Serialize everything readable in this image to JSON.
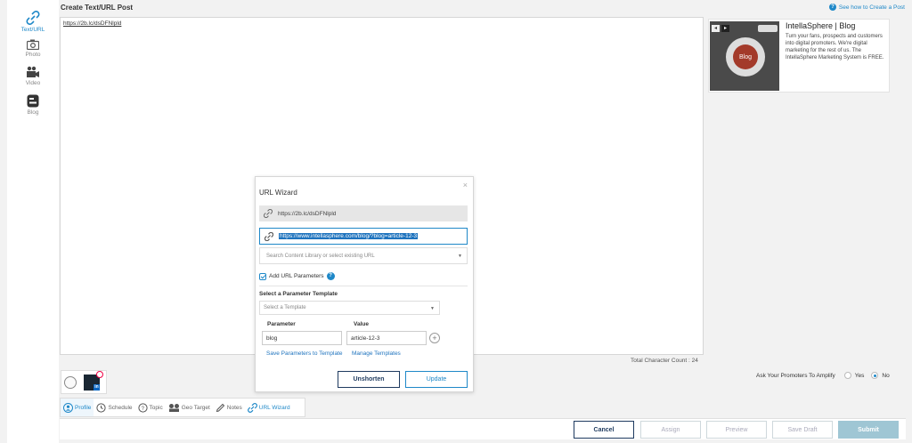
{
  "header": {
    "title": "Create Text/URL Post",
    "help_link": "See how to Create a Post"
  },
  "sidebar": {
    "items": [
      {
        "label": "Text/URL",
        "icon": "link-icon",
        "active": true
      },
      {
        "label": "Photo",
        "icon": "camera-icon"
      },
      {
        "label": "Video",
        "icon": "video-camera-icon"
      },
      {
        "label": "Blog",
        "icon": "blog-icon"
      }
    ]
  },
  "editor": {
    "text": "https://2b.lc/dsDFNlpld"
  },
  "preview": {
    "title": "IntellaSphere | Blog",
    "description": "Turn your fans, prospects and customers into digital promoters. We're digital marketing for the rest of us. The IntellaSphere Marketing System is FREE.",
    "thumb_label": "Blog"
  },
  "wizard": {
    "title": "URL Wizard",
    "short_url": "https://2b.lc/dsDFNlpld",
    "long_url": "https://www.intellasphere.com/blog/?blog=article-12-3",
    "search_placeholder": "Search Content Library or select existing URL",
    "add_params_label": "Add URL Parameters",
    "select_template_label": "Select a Parameter Template",
    "template_placeholder": "Select a Template",
    "parameter_header": "Parameter",
    "value_header": "Value",
    "parameter_value": "blog",
    "value_value": "article-12-3",
    "save_link": "Save Parameters to Template",
    "manage_link": "Manage Templates",
    "unshorten_label": "Unshorten",
    "update_label": "Update"
  },
  "status": {
    "char_count": "Total Character Count : 24",
    "amplify_label": "Ask Your Promoters To Amplify",
    "yes_label": "Yes",
    "no_label": "No"
  },
  "tabs": [
    {
      "label": "Profile"
    },
    {
      "label": "Schedule"
    },
    {
      "label": "Topic"
    },
    {
      "label": "Geo Target"
    },
    {
      "label": "Notes"
    },
    {
      "label": "URL Wizard"
    }
  ],
  "footer": {
    "cancel": "Cancel",
    "assign": "Assign",
    "preview": "Preview",
    "save_draft": "Save Draft",
    "submit": "Submit"
  },
  "colors": {
    "accent": "#1e88c8",
    "dark": "#1e3a5f",
    "submit": "#9fc6d4"
  }
}
